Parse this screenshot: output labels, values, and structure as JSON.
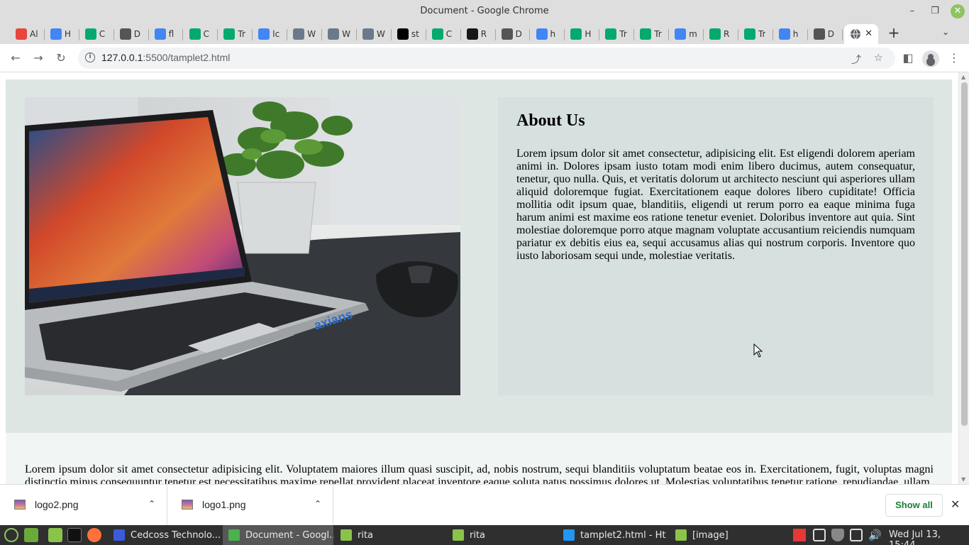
{
  "window": {
    "title": "Document - Google Chrome",
    "controls": {
      "minimize": "–",
      "maximize": "❐",
      "close": "✕"
    }
  },
  "tabs": [
    {
      "label": "Al",
      "favicon": "cedcoss-icon",
      "color": "#e8453c"
    },
    {
      "label": "H",
      "favicon": "cedcoss-icon",
      "color": "#4285f4"
    },
    {
      "label": "C",
      "favicon": "w3schools-icon",
      "color": "#04aa6d"
    },
    {
      "label": "D",
      "favicon": "globe-icon",
      "color": "#555555"
    },
    {
      "label": "fl",
      "favicon": "google-icon",
      "color": "#4285f4"
    },
    {
      "label": "C",
      "favicon": "w3schools-icon",
      "color": "#04aa6d"
    },
    {
      "label": "Tr",
      "favicon": "w3schools-icon",
      "color": "#04aa6d"
    },
    {
      "label": "lc",
      "favicon": "google-icon",
      "color": "#4285f4"
    },
    {
      "label": "W",
      "favicon": "avatar-icon",
      "color": "#6a7a8a"
    },
    {
      "label": "W",
      "favicon": "avatar-icon",
      "color": "#6a7a8a"
    },
    {
      "label": "W",
      "favicon": "avatar-icon",
      "color": "#6a7a8a"
    },
    {
      "label": "st",
      "favicon": "medium-icon",
      "color": "#000000"
    },
    {
      "label": "C",
      "favicon": "w3schools-icon",
      "color": "#04aa6d"
    },
    {
      "label": "R",
      "favicon": "github-icon",
      "color": "#181717"
    },
    {
      "label": "D",
      "favicon": "globe-icon",
      "color": "#555555"
    },
    {
      "label": "h",
      "favicon": "google-icon",
      "color": "#4285f4"
    },
    {
      "label": "H",
      "favicon": "w3schools-icon",
      "color": "#04aa6d"
    },
    {
      "label": "Tr",
      "favicon": "w3schools-icon",
      "color": "#04aa6d"
    },
    {
      "label": "Tr",
      "favicon": "w3schools-icon",
      "color": "#04aa6d"
    },
    {
      "label": "m",
      "favicon": "google-icon",
      "color": "#4285f4"
    },
    {
      "label": "R",
      "favicon": "w3schools-icon",
      "color": "#04aa6d"
    },
    {
      "label": "Tr",
      "favicon": "w3schools-icon",
      "color": "#04aa6d"
    },
    {
      "label": "h",
      "favicon": "google-icon",
      "color": "#4285f4"
    },
    {
      "label": "D",
      "favicon": "globe-icon",
      "color": "#555555"
    }
  ],
  "active_tab": {
    "favicon": "globe-icon",
    "close": "✕"
  },
  "new_tab": "+",
  "tab_search": "⌄",
  "toolbar": {
    "back": "←",
    "forward": "→",
    "reload": "↻",
    "url_host": "127.0.0.1",
    "url_path": ":5500/tamplet2.html",
    "share": "⤴",
    "star": "☆",
    "sidepanel": "◧",
    "menu": "⋮"
  },
  "page": {
    "about_heading": "About Us",
    "about_text": "Lorem ipsum dolor sit amet consectetur, adipisicing elit. Est eligendi dolorem aperiam animi in. Dolores ipsam iusto totam modi enim libero ducimus, autem consequatur, tenetur, quo nulla. Quis, et veritatis dolorum ut architecto nesciunt qui asperiores ullam aliquid doloremque fugiat. Exercitationem eaque dolores libero cupiditate! Officia mollitia odit ipsum quae, blanditiis, eligendi ut rerum porro ea eaque minima fuga harum animi est maxime eos ratione tenetur eveniet. Doloribus inventore aut quia. Sint molestiae doloremque porro atque magnam voluptate accusantium reiciendis numquam pariatur ex debitis eius ea, sequi accusamus alias qui nostrum corporis. Inventore quo iusto laboriosam sequi unde, molestiae veritatis.",
    "second_text": "Lorem ipsum dolor sit amet consectetur adipisicing elit. Voluptatem maiores illum quasi suscipit, ad, nobis nostrum, sequi blanditiis voluptatum beatae eos in. Exercitationem, fugit, voluptas magni distinctio minus consequuntur tenetur est necessitatibus maxime repellat provident placeat inventore eaque soluta natus possimus dolores ut. Molestias voluptatibus tenetur ratione, repudiandae, ullam",
    "laptop_brand": "axians"
  },
  "downloads": {
    "items": [
      {
        "name": "logo2.png",
        "chevron": "⌃"
      },
      {
        "name": "logo1.png",
        "chevron": "⌃"
      }
    ],
    "show_all": "Show all",
    "close": "✕"
  },
  "taskbar": {
    "apps": [
      {
        "label": "Cedcoss Technolo...",
        "icon": "chat-icon",
        "color": "#3b5bdb"
      },
      {
        "label": "Document - Googl...",
        "icon": "chrome-icon",
        "color": "#4caf50"
      },
      {
        "label": "rita",
        "icon": "folder-icon",
        "color": "#8bc34a"
      },
      {
        "label": "rita",
        "icon": "folder-icon",
        "color": "#8bc34a"
      },
      {
        "label": "tamplet2.html - Ht...",
        "icon": "vscode-icon",
        "color": "#2196f3"
      },
      {
        "label": "[image]",
        "icon": "folder-icon",
        "color": "#8bc34a"
      }
    ],
    "clock": "Wed Jul 13, 15:44"
  }
}
